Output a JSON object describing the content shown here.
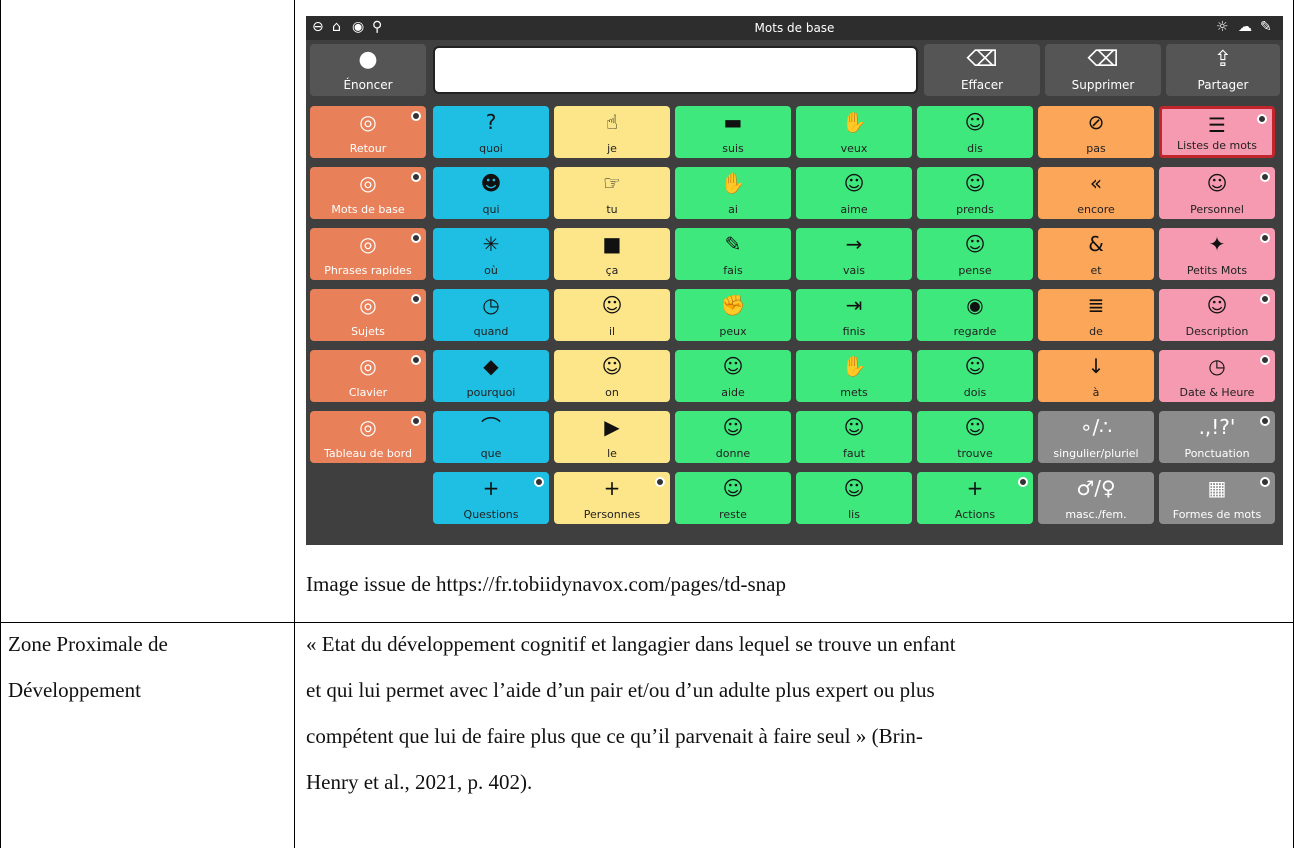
{
  "app": {
    "screen_title": "Mots de base",
    "top_left_icons": [
      "back-circle-icon",
      "home-icon",
      "dashboard-icon",
      "search-icon"
    ],
    "top_right_icons": [
      "brightness-icon",
      "cloud-sync-icon",
      "edit-off-icon"
    ]
  },
  "toolbar": {
    "speak_label": "Énoncer",
    "clear_label": "Effacer",
    "delete_label": "Supprimer",
    "share_label": "Partager",
    "message_value": ""
  },
  "nav": [
    {
      "label": "Retour",
      "icon": "back-arrow-icon"
    },
    {
      "label": "Mots de base",
      "icon": "target-icon"
    },
    {
      "label": "Phrases rapides",
      "icon": "fire-icon"
    },
    {
      "label": "Sujets",
      "icon": "speech-bubble-icon"
    },
    {
      "label": "Clavier",
      "icon": "keyboard-icon"
    },
    {
      "label": "Tableau de bord",
      "icon": "dashboard-icon"
    }
  ],
  "grid": [
    [
      {
        "label": "quoi",
        "color": "blue",
        "glyph": "?"
      },
      {
        "label": "je",
        "color": "yellow",
        "glyph": "☝"
      },
      {
        "label": "suis",
        "color": "green",
        "glyph": "▬"
      },
      {
        "label": "veux",
        "color": "green",
        "glyph": "✋"
      },
      {
        "label": "dis",
        "color": "green",
        "glyph": "☺"
      },
      {
        "label": "pas",
        "color": "orange",
        "glyph": "⊘"
      },
      {
        "label": "Listes de mots",
        "color": "pink",
        "glyph": "☰",
        "folder": true,
        "selected": true
      }
    ],
    [
      {
        "label": "qui",
        "color": "blue",
        "glyph": "☻"
      },
      {
        "label": "tu",
        "color": "yellow",
        "glyph": "☞"
      },
      {
        "label": "ai",
        "color": "green",
        "glyph": "✋"
      },
      {
        "label": "aime",
        "color": "green",
        "glyph": "☺"
      },
      {
        "label": "prends",
        "color": "green",
        "glyph": "☺"
      },
      {
        "label": "encore",
        "color": "orange",
        "glyph": "«"
      },
      {
        "label": "Personnel",
        "color": "pink",
        "glyph": "☺",
        "folder": true
      }
    ],
    [
      {
        "label": "où",
        "color": "blue",
        "glyph": "✳"
      },
      {
        "label": "ça",
        "color": "yellow",
        "glyph": "■"
      },
      {
        "label": "fais",
        "color": "green",
        "glyph": "✎"
      },
      {
        "label": "vais",
        "color": "green",
        "glyph": "→"
      },
      {
        "label": "pense",
        "color": "green",
        "glyph": "☺"
      },
      {
        "label": "et",
        "color": "orange",
        "glyph": "&"
      },
      {
        "label": "Petits Mots",
        "color": "pink",
        "glyph": "✦",
        "folder": true
      }
    ],
    [
      {
        "label": "quand",
        "color": "blue",
        "glyph": "◷"
      },
      {
        "label": "il",
        "color": "yellow",
        "glyph": "☺"
      },
      {
        "label": "peux",
        "color": "green",
        "glyph": "✊"
      },
      {
        "label": "finis",
        "color": "green",
        "glyph": "⇥"
      },
      {
        "label": "regarde",
        "color": "green",
        "glyph": "◉"
      },
      {
        "label": "de",
        "color": "orange",
        "glyph": "≣"
      },
      {
        "label": "Description",
        "color": "pink",
        "glyph": "☺",
        "folder": true
      }
    ],
    [
      {
        "label": "pourquoi",
        "color": "blue",
        "glyph": "◆"
      },
      {
        "label": "on",
        "color": "yellow",
        "glyph": "☺"
      },
      {
        "label": "aide",
        "color": "green",
        "glyph": "☺"
      },
      {
        "label": "mets",
        "color": "green",
        "glyph": "✋"
      },
      {
        "label": "dois",
        "color": "green",
        "glyph": "☺"
      },
      {
        "label": "à",
        "color": "orange",
        "glyph": "↓"
      },
      {
        "label": "Date & Heure",
        "color": "pink",
        "glyph": "◷",
        "folder": true
      }
    ],
    [
      {
        "label": "que",
        "color": "blue",
        "glyph": "⌒"
      },
      {
        "label": "le",
        "color": "yellow",
        "glyph": "▶"
      },
      {
        "label": "donne",
        "color": "green",
        "glyph": "☺"
      },
      {
        "label": "faut",
        "color": "green",
        "glyph": "☺"
      },
      {
        "label": "trouve",
        "color": "green",
        "glyph": "☺"
      },
      {
        "label": "singulier/pluriel",
        "color": "gray",
        "glyph": "∘/∴"
      },
      {
        "label": "Ponctuation",
        "color": "gray",
        "glyph": ".,!?'",
        "folder": true
      }
    ],
    [
      {
        "label": "Questions",
        "color": "blue",
        "glyph": "+",
        "folder": true
      },
      {
        "label": "Personnes",
        "color": "yellow",
        "glyph": "+",
        "folder": true
      },
      {
        "label": "reste",
        "color": "green",
        "glyph": "☺"
      },
      {
        "label": "lis",
        "color": "green",
        "glyph": "☺"
      },
      {
        "label": "Actions",
        "color": "green",
        "glyph": "+",
        "folder": true
      },
      {
        "label": "masc./fem.",
        "color": "gray",
        "glyph": "♂/♀"
      },
      {
        "label": "Formes de mots",
        "color": "gray",
        "glyph": "▦",
        "folder": true
      }
    ]
  ],
  "doc": {
    "caption": "Image issue de https://fr.tobiidynavox.com/pages/td-snap",
    "term_line1": "Zone Proximale de",
    "term_line2": "Développement",
    "def_line1": " « Etat du développement cognitif et langagier dans lequel se trouve un enfant",
    "def_line2": "et qui lui permet avec l’aide d’un pair et/ou d’un adulte plus expert ou plus",
    "def_line3": "compétent que lui de faire plus que ce qu’il parvenait à faire seul » (Brin-",
    "def_line4": "Henry et al., 2021, p. 402)."
  }
}
